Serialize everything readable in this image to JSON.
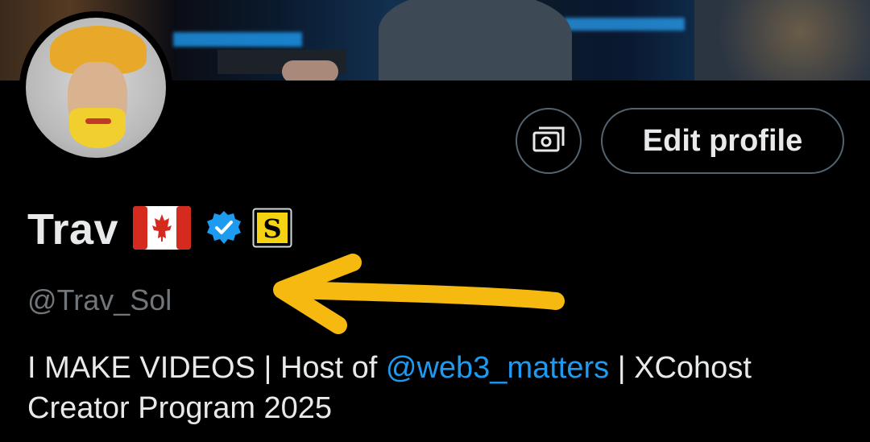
{
  "profile": {
    "display_name": "Trav",
    "flag_emoji_name": "canada-flag",
    "verified": true,
    "affiliate_badge_letter": "S",
    "handle": "@Trav_Sol",
    "bio": {
      "part1": "I MAKE VIDEOS | Host of ",
      "mention": "@web3_matters",
      "part2": " | XCohost Creator Program 2025"
    }
  },
  "actions": {
    "edit_profile_label": "Edit profile",
    "subscriptions_icon": "money-icon"
  },
  "colors": {
    "background": "#000000",
    "text": "#e7e9ea",
    "muted": "#71767b",
    "link": "#1d9bf0",
    "verified": "#1d9bf0",
    "border": "#536471",
    "annotation_arrow": "#f5b90f"
  }
}
